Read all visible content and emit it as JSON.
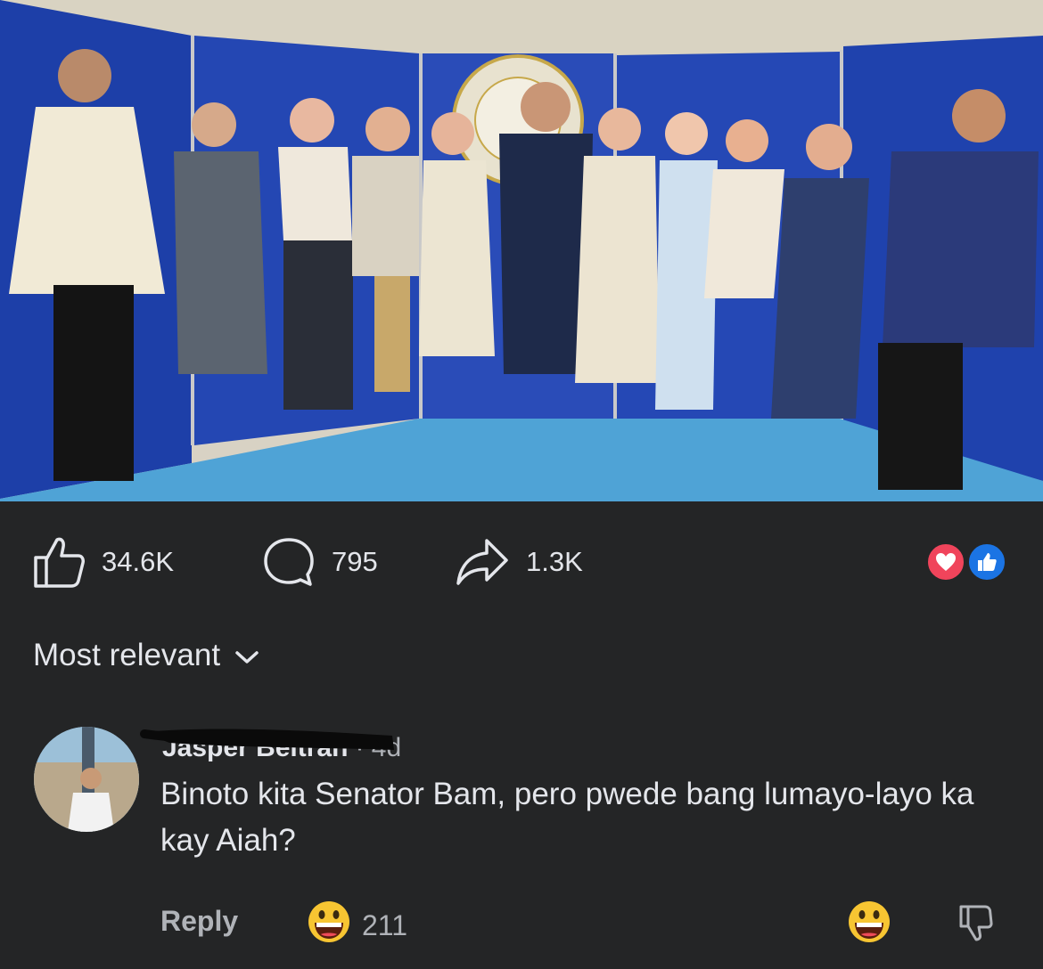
{
  "post": {
    "likes_count": "34.6K",
    "comments_count": "795",
    "shares_count": "1.3K",
    "reaction_icons": [
      "love-icon",
      "like-icon"
    ]
  },
  "sort": {
    "label": "Most relevant"
  },
  "comment": {
    "author": "Jasper Beltran",
    "time": "4d",
    "text": "Binoto kita Senator Bam, pero pwede bang lumayo-layo ka kay Aiah?",
    "reply_label": "Reply",
    "reaction_count": "211",
    "reaction_icon": "grinning-face-icon"
  },
  "colors": {
    "background": "#242526",
    "text_primary": "#e4e6eb",
    "text_secondary": "#b0b3b8",
    "love": "#f0445b",
    "like": "#1b74e4"
  }
}
